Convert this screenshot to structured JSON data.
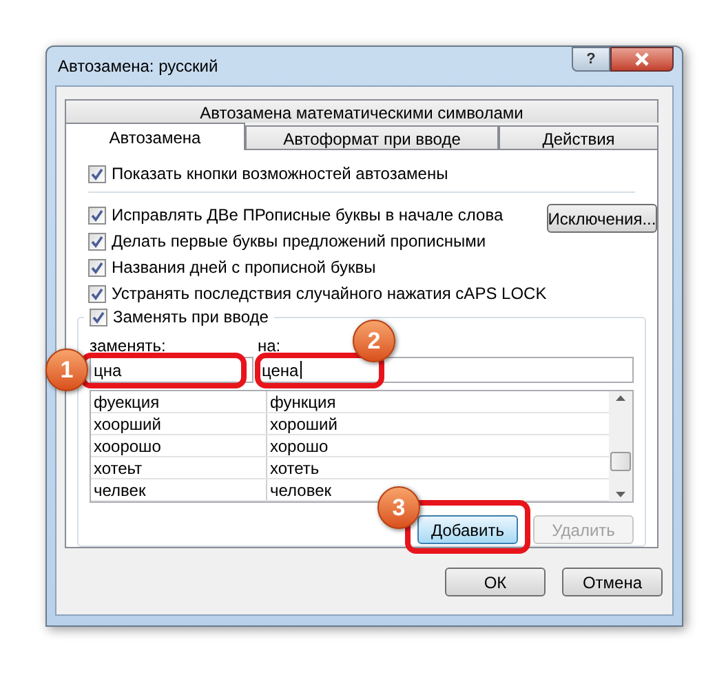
{
  "window": {
    "title": "Автозамена: русский",
    "help_button": "?"
  },
  "tabs_top": [
    {
      "label": "Автозамена математическими символами",
      "selected": false
    }
  ],
  "tabs": [
    {
      "label": "Автозамена",
      "selected": true
    },
    {
      "label": "Автоформат при вводе",
      "selected": false
    },
    {
      "label": "Действия",
      "selected": false
    }
  ],
  "show_buttons": {
    "label": "Показать кнопки возможностей автозамены",
    "checked": true
  },
  "options": [
    {
      "label": "Исправлять ДВе ПРописные буквы в начале слова",
      "checked": true
    },
    {
      "label": "Делать первые буквы предложений прописными",
      "checked": true
    },
    {
      "label": "Названия дней с прописной буквы",
      "checked": true
    },
    {
      "label": "Устранять последствия случайного нажатия cAPS LOCK",
      "checked": true
    }
  ],
  "exceptions_button": {
    "label": "Исключения...",
    "disabled": false
  },
  "replace_group": {
    "label": "Заменять при вводе",
    "checked": true,
    "find_label": "заменять:",
    "with_label": "на:",
    "find_value": "цна",
    "with_value": "цена",
    "with_focused": true,
    "rows": [
      {
        "find": "фуекция",
        "replace": "функция"
      },
      {
        "find": "хоорший",
        "replace": "хороший"
      },
      {
        "find": "хоорошо",
        "replace": "хорошо"
      },
      {
        "find": "хотеьт",
        "replace": "хотеть"
      },
      {
        "find": "челвек",
        "replace": "человек"
      }
    ],
    "buttons": [
      {
        "label": "Добавить",
        "default": true,
        "disabled": false
      },
      {
        "label": "Удалить",
        "default": false,
        "disabled": true
      }
    ]
  },
  "dialog_buttons": [
    {
      "label": "ОК",
      "disabled": false
    },
    {
      "label": "Отмена",
      "disabled": false
    }
  ],
  "annotations": [
    {
      "number": "1"
    },
    {
      "number": "2"
    },
    {
      "number": "3"
    }
  ]
}
